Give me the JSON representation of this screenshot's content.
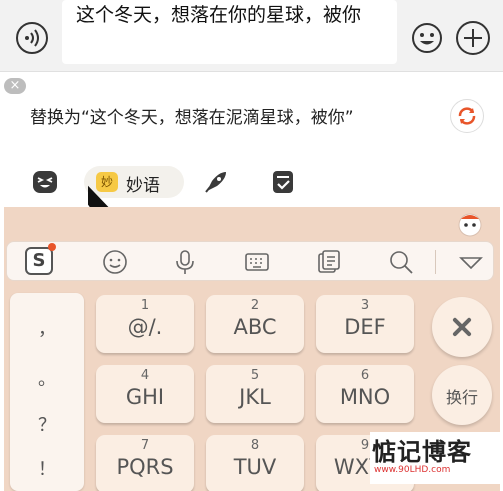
{
  "chat_input": {
    "text": "这个冬天，想落在你的星球，被你",
    "voice_icon": "voice-wave-icon",
    "emoji_icon": "smiley-icon",
    "plus_icon": "plus-icon"
  },
  "suggestion": {
    "dismiss_label": "×",
    "text": "替换为“这个冬天，想落在泥滴星球，被你”",
    "refresh_icon": "refresh-icon"
  },
  "tabs": {
    "miaoyu_badge": "妙",
    "miaoyu_label": "妙语",
    "items": [
      "expression-face-icon",
      "miaoyu-tab",
      "rocket-icon",
      "check-note-icon"
    ]
  },
  "keyboard": {
    "logo_label": "S",
    "punctuation": [
      "，",
      "。",
      "？",
      "！"
    ],
    "keys": [
      {
        "num": "1",
        "letters": "@/."
      },
      {
        "num": "2",
        "letters": "ABC"
      },
      {
        "num": "3",
        "letters": "DEF"
      },
      {
        "num": "4",
        "letters": "GHI"
      },
      {
        "num": "5",
        "letters": "JKL"
      },
      {
        "num": "6",
        "letters": "MNO"
      },
      {
        "num": "7",
        "letters": "PQRS"
      },
      {
        "num": "8",
        "letters": "TUV"
      },
      {
        "num": "9",
        "letters": "WXYZ"
      }
    ],
    "newline_label": "换行",
    "toolbar_icons": [
      "sogou-logo-icon",
      "emoji-icon",
      "microphone-icon",
      "keyboard-icon",
      "clipboard-icon",
      "search-icon",
      "collapse-icon"
    ]
  },
  "watermark": {
    "title": "惦记博客",
    "url": "www.90LHD.com"
  },
  "colors": {
    "keyboard_bg": "#f0d6c4",
    "key_bg": "#fbeee3",
    "miaoyu_badge": "#f6c945",
    "refresh_accent": "#e8552a"
  }
}
